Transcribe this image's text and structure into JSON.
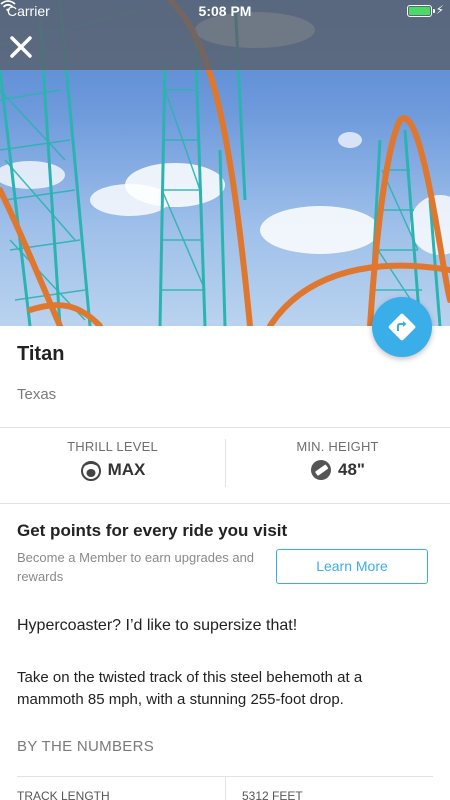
{
  "status_bar": {
    "carrier": "Carrier",
    "time": "5:08 PM",
    "battery_level": 1.0
  },
  "header": {
    "close_icon": "close-icon",
    "directions_icon": "directions-icon"
  },
  "ride": {
    "name": "Titan",
    "location": "Texas"
  },
  "stats": [
    {
      "label": "THRILL LEVEL",
      "value": "MAX",
      "icon": "thrill-face-icon"
    },
    {
      "label": "MIN. HEIGHT",
      "value": "48\"",
      "icon": "height-ruler-icon"
    }
  ],
  "promo": {
    "title": "Get points for every ride you visit",
    "text": "Become a Member to earn upgrades and rewards",
    "button_label": "Learn More"
  },
  "tagline": "Hypercoaster? I’d like to supersize that!",
  "description": "Take on the twisted track of this steel behemoth at a mammoth 85 mph, with a stunning 255-foot drop.",
  "numbers": {
    "heading": "BY THE NUMBERS",
    "rows": [
      {
        "label": "TRACK LENGTH",
        "value": "5312 FEET"
      }
    ]
  },
  "colors": {
    "accent": "#3aaee8",
    "coaster_orange": "#e0772f",
    "coaster_teal": "#2bb3b1"
  }
}
